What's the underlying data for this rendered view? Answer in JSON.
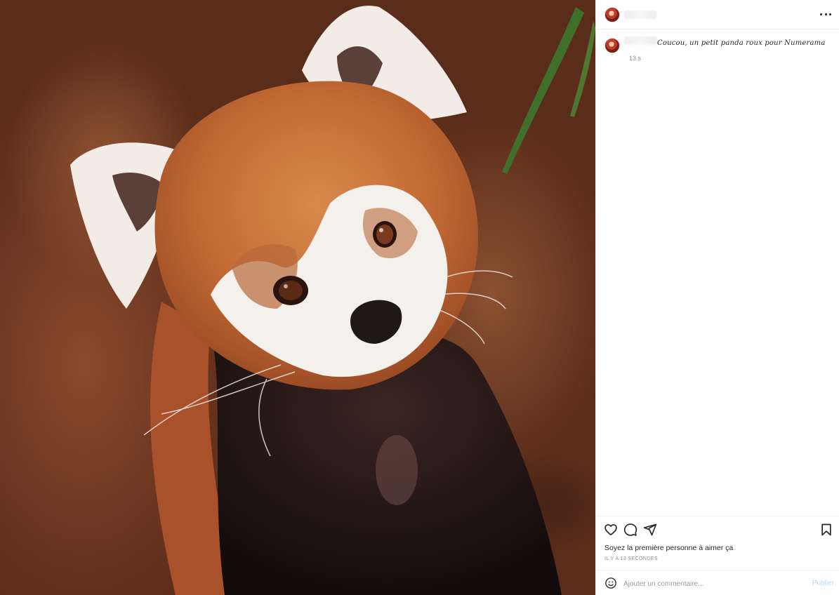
{
  "post": {
    "image_alt": "red panda",
    "caption": "Coucou, un petit panda roux pour Numerama",
    "caption_time": "13 s",
    "likes_prefix": "Soyez la première personne à ",
    "likes_link": "aimer ça",
    "timestamp": "IL Y A 13 SECONDES"
  },
  "comment": {
    "placeholder": "Ajouter un commentaire...",
    "publish_label": "Publier"
  },
  "icons": {
    "more": "more-options-icon",
    "like": "heart-icon",
    "comment": "comment-icon",
    "share": "share-icon",
    "save": "bookmark-icon",
    "emoji": "emoji-icon"
  },
  "colors": {
    "publish": "#b3dbff",
    "border": "#efefef",
    "muted": "#8e8e8e"
  }
}
